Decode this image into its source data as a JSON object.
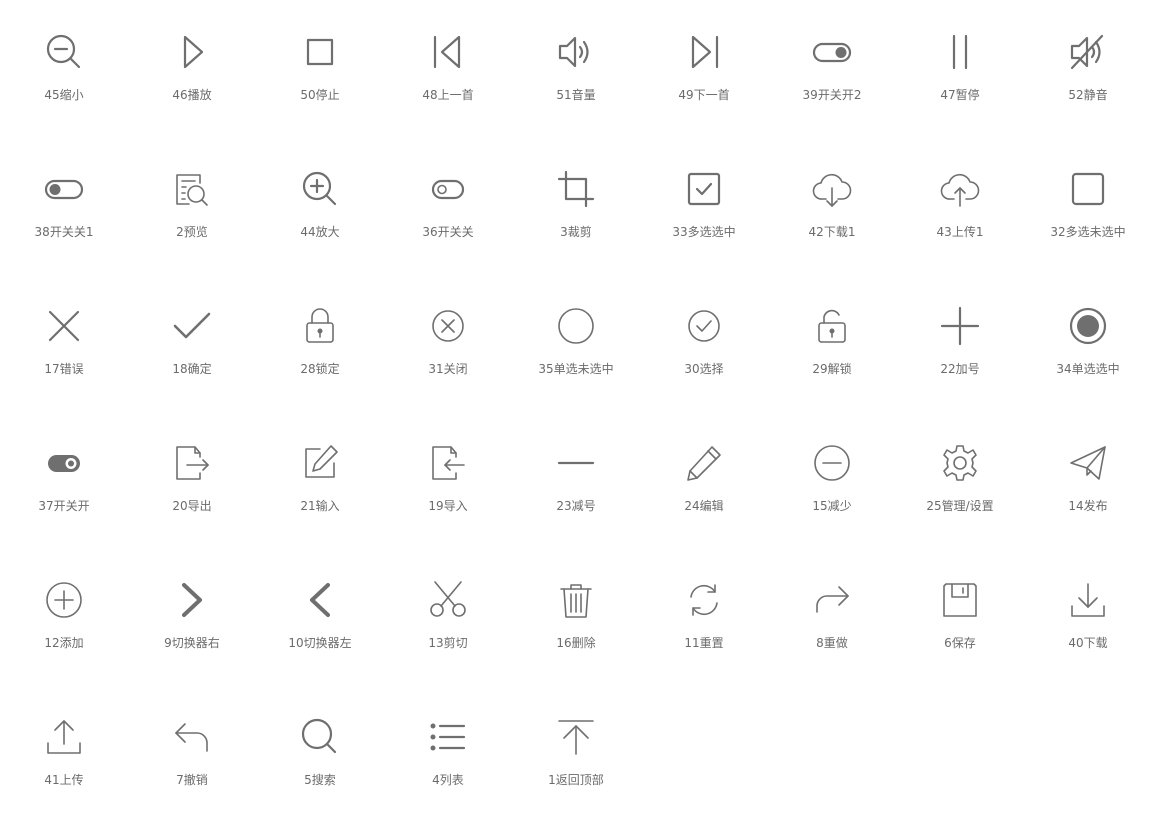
{
  "icons": [
    {
      "id": "45",
      "label": "45缩小",
      "icon": "zoom-out-icon"
    },
    {
      "id": "46",
      "label": "46播放",
      "icon": "play-icon"
    },
    {
      "id": "50",
      "label": "50停止",
      "icon": "stop-icon"
    },
    {
      "id": "48",
      "label": "48上一首",
      "icon": "previous-track-icon"
    },
    {
      "id": "51",
      "label": "51音量",
      "icon": "volume-icon"
    },
    {
      "id": "49",
      "label": "49下一首",
      "icon": "next-track-icon"
    },
    {
      "id": "39",
      "label": "39开关开2",
      "icon": "toggle-on-2-icon"
    },
    {
      "id": "47",
      "label": "47暂停",
      "icon": "pause-icon"
    },
    {
      "id": "52",
      "label": "52静音",
      "icon": "mute-icon"
    },
    {
      "id": "38",
      "label": "38开关关1",
      "icon": "toggle-off-1-icon"
    },
    {
      "id": "2",
      "label": "2预览",
      "icon": "preview-icon"
    },
    {
      "id": "44",
      "label": "44放大",
      "icon": "zoom-in-icon"
    },
    {
      "id": "36",
      "label": "36开关关",
      "icon": "toggle-off-icon"
    },
    {
      "id": "3",
      "label": "3裁剪",
      "icon": "crop-icon"
    },
    {
      "id": "33",
      "label": "33多选选中",
      "icon": "checkbox-checked-icon"
    },
    {
      "id": "42",
      "label": "42下载1",
      "icon": "cloud-download-icon"
    },
    {
      "id": "43",
      "label": "43上传1",
      "icon": "cloud-upload-icon"
    },
    {
      "id": "32",
      "label": "32多选未选中",
      "icon": "checkbox-unchecked-icon"
    },
    {
      "id": "17",
      "label": "17错误",
      "icon": "close-x-icon"
    },
    {
      "id": "18",
      "label": "18确定",
      "icon": "checkmark-icon"
    },
    {
      "id": "28",
      "label": "28锁定",
      "icon": "lock-icon"
    },
    {
      "id": "31",
      "label": "31关闭",
      "icon": "close-circle-icon"
    },
    {
      "id": "35",
      "label": "35单选未选中",
      "icon": "radio-unchecked-icon"
    },
    {
      "id": "30",
      "label": "30选择",
      "icon": "check-circle-icon"
    },
    {
      "id": "29",
      "label": "29解锁",
      "icon": "unlock-icon"
    },
    {
      "id": "22",
      "label": "22加号",
      "icon": "plus-icon"
    },
    {
      "id": "34",
      "label": "34单选选中",
      "icon": "radio-checked-icon"
    },
    {
      "id": "37",
      "label": "37开关开",
      "icon": "toggle-on-icon"
    },
    {
      "id": "20",
      "label": "20导出",
      "icon": "export-icon"
    },
    {
      "id": "21",
      "label": "21输入",
      "icon": "edit-input-icon"
    },
    {
      "id": "19",
      "label": "19导入",
      "icon": "import-icon"
    },
    {
      "id": "23",
      "label": "23减号",
      "icon": "minus-icon"
    },
    {
      "id": "24",
      "label": "24编辑",
      "icon": "pencil-icon"
    },
    {
      "id": "15",
      "label": "15减少",
      "icon": "minus-circle-icon"
    },
    {
      "id": "25",
      "label": "25管理/设置",
      "icon": "gear-icon"
    },
    {
      "id": "14",
      "label": "14发布",
      "icon": "send-icon"
    },
    {
      "id": "12",
      "label": "12添加",
      "icon": "add-circle-icon"
    },
    {
      "id": "9",
      "label": "9切换器右",
      "icon": "chevron-right-icon"
    },
    {
      "id": "10",
      "label": "10切换器左",
      "icon": "chevron-left-icon"
    },
    {
      "id": "13",
      "label": "13剪切",
      "icon": "scissors-icon"
    },
    {
      "id": "16",
      "label": "16删除",
      "icon": "trash-icon"
    },
    {
      "id": "11",
      "label": "11重置",
      "icon": "refresh-icon"
    },
    {
      "id": "8",
      "label": "8重做",
      "icon": "redo-icon"
    },
    {
      "id": "6",
      "label": "6保存",
      "icon": "save-icon"
    },
    {
      "id": "40",
      "label": "40下载",
      "icon": "download-icon"
    },
    {
      "id": "41",
      "label": "41上传",
      "icon": "upload-icon"
    },
    {
      "id": "7",
      "label": "7撤销",
      "icon": "undo-icon"
    },
    {
      "id": "5",
      "label": "5搜索",
      "icon": "search-icon"
    },
    {
      "id": "4",
      "label": "4列表",
      "icon": "list-icon"
    },
    {
      "id": "1",
      "label": "1返回顶部",
      "icon": "back-to-top-icon"
    }
  ],
  "colors": {
    "icon": "#6f6f6f",
    "label": "#6b6b6b",
    "background": "#ffffff"
  }
}
